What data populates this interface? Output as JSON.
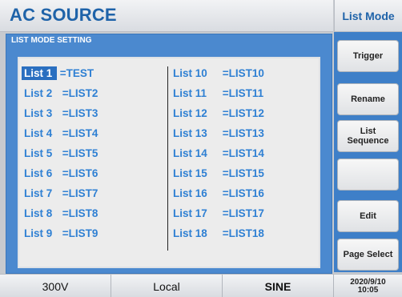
{
  "header": {
    "title": "AC SOURCE",
    "mode": "List Mode"
  },
  "panel": {
    "title": "LIST MODE SETTING"
  },
  "lists_left": [
    {
      "key": "List 1",
      "sep": " =",
      "name": "TEST"
    },
    {
      "key": "List 2",
      "sep": " =",
      "name": "LIST2"
    },
    {
      "key": "List 3",
      "sep": " =",
      "name": "LIST3"
    },
    {
      "key": "List 4",
      "sep": " =",
      "name": "LIST4"
    },
    {
      "key": "List 5",
      "sep": " =",
      "name": "LIST5"
    },
    {
      "key": "List 6",
      "sep": " =",
      "name": "LIST6"
    },
    {
      "key": "List 7",
      "sep": " =",
      "name": "LIST7"
    },
    {
      "key": "List 8",
      "sep": " =",
      "name": "LIST8"
    },
    {
      "key": "List 9",
      "sep": " =",
      "name": "LIST9"
    }
  ],
  "lists_right": [
    {
      "key": "List 10",
      "sep": " =",
      "name": "LIST10"
    },
    {
      "key": "List 11",
      "sep": " =",
      "name": "LIST11"
    },
    {
      "key": "List 12",
      "sep": " =",
      "name": "LIST12"
    },
    {
      "key": "List 13",
      "sep": " =",
      "name": "LIST13"
    },
    {
      "key": "List 14",
      "sep": " =",
      "name": "LIST14"
    },
    {
      "key": "List 15",
      "sep": " =",
      "name": "LIST15"
    },
    {
      "key": "List 16",
      "sep": " =",
      "name": "LIST16"
    },
    {
      "key": "List 17",
      "sep": " =",
      "name": "LIST17"
    },
    {
      "key": "List 18",
      "sep": " =",
      "name": "LIST18"
    }
  ],
  "sidebar": {
    "trigger": "Trigger",
    "rename": "Rename",
    "list_sequence_line1": "List",
    "list_sequence_line2": "Sequence",
    "blank": "",
    "edit": "Edit",
    "page_select": "Page Select"
  },
  "status": {
    "voltage": "300V",
    "control": "Local",
    "waveform": "SINE",
    "date": "2020/9/10",
    "time": "10:05"
  },
  "colors": {
    "brand_blue": "#1f63a9",
    "panel_blue": "#4b89cf",
    "list_text_blue": "#2f80d3",
    "selection_blue": "#2a6fc0"
  }
}
